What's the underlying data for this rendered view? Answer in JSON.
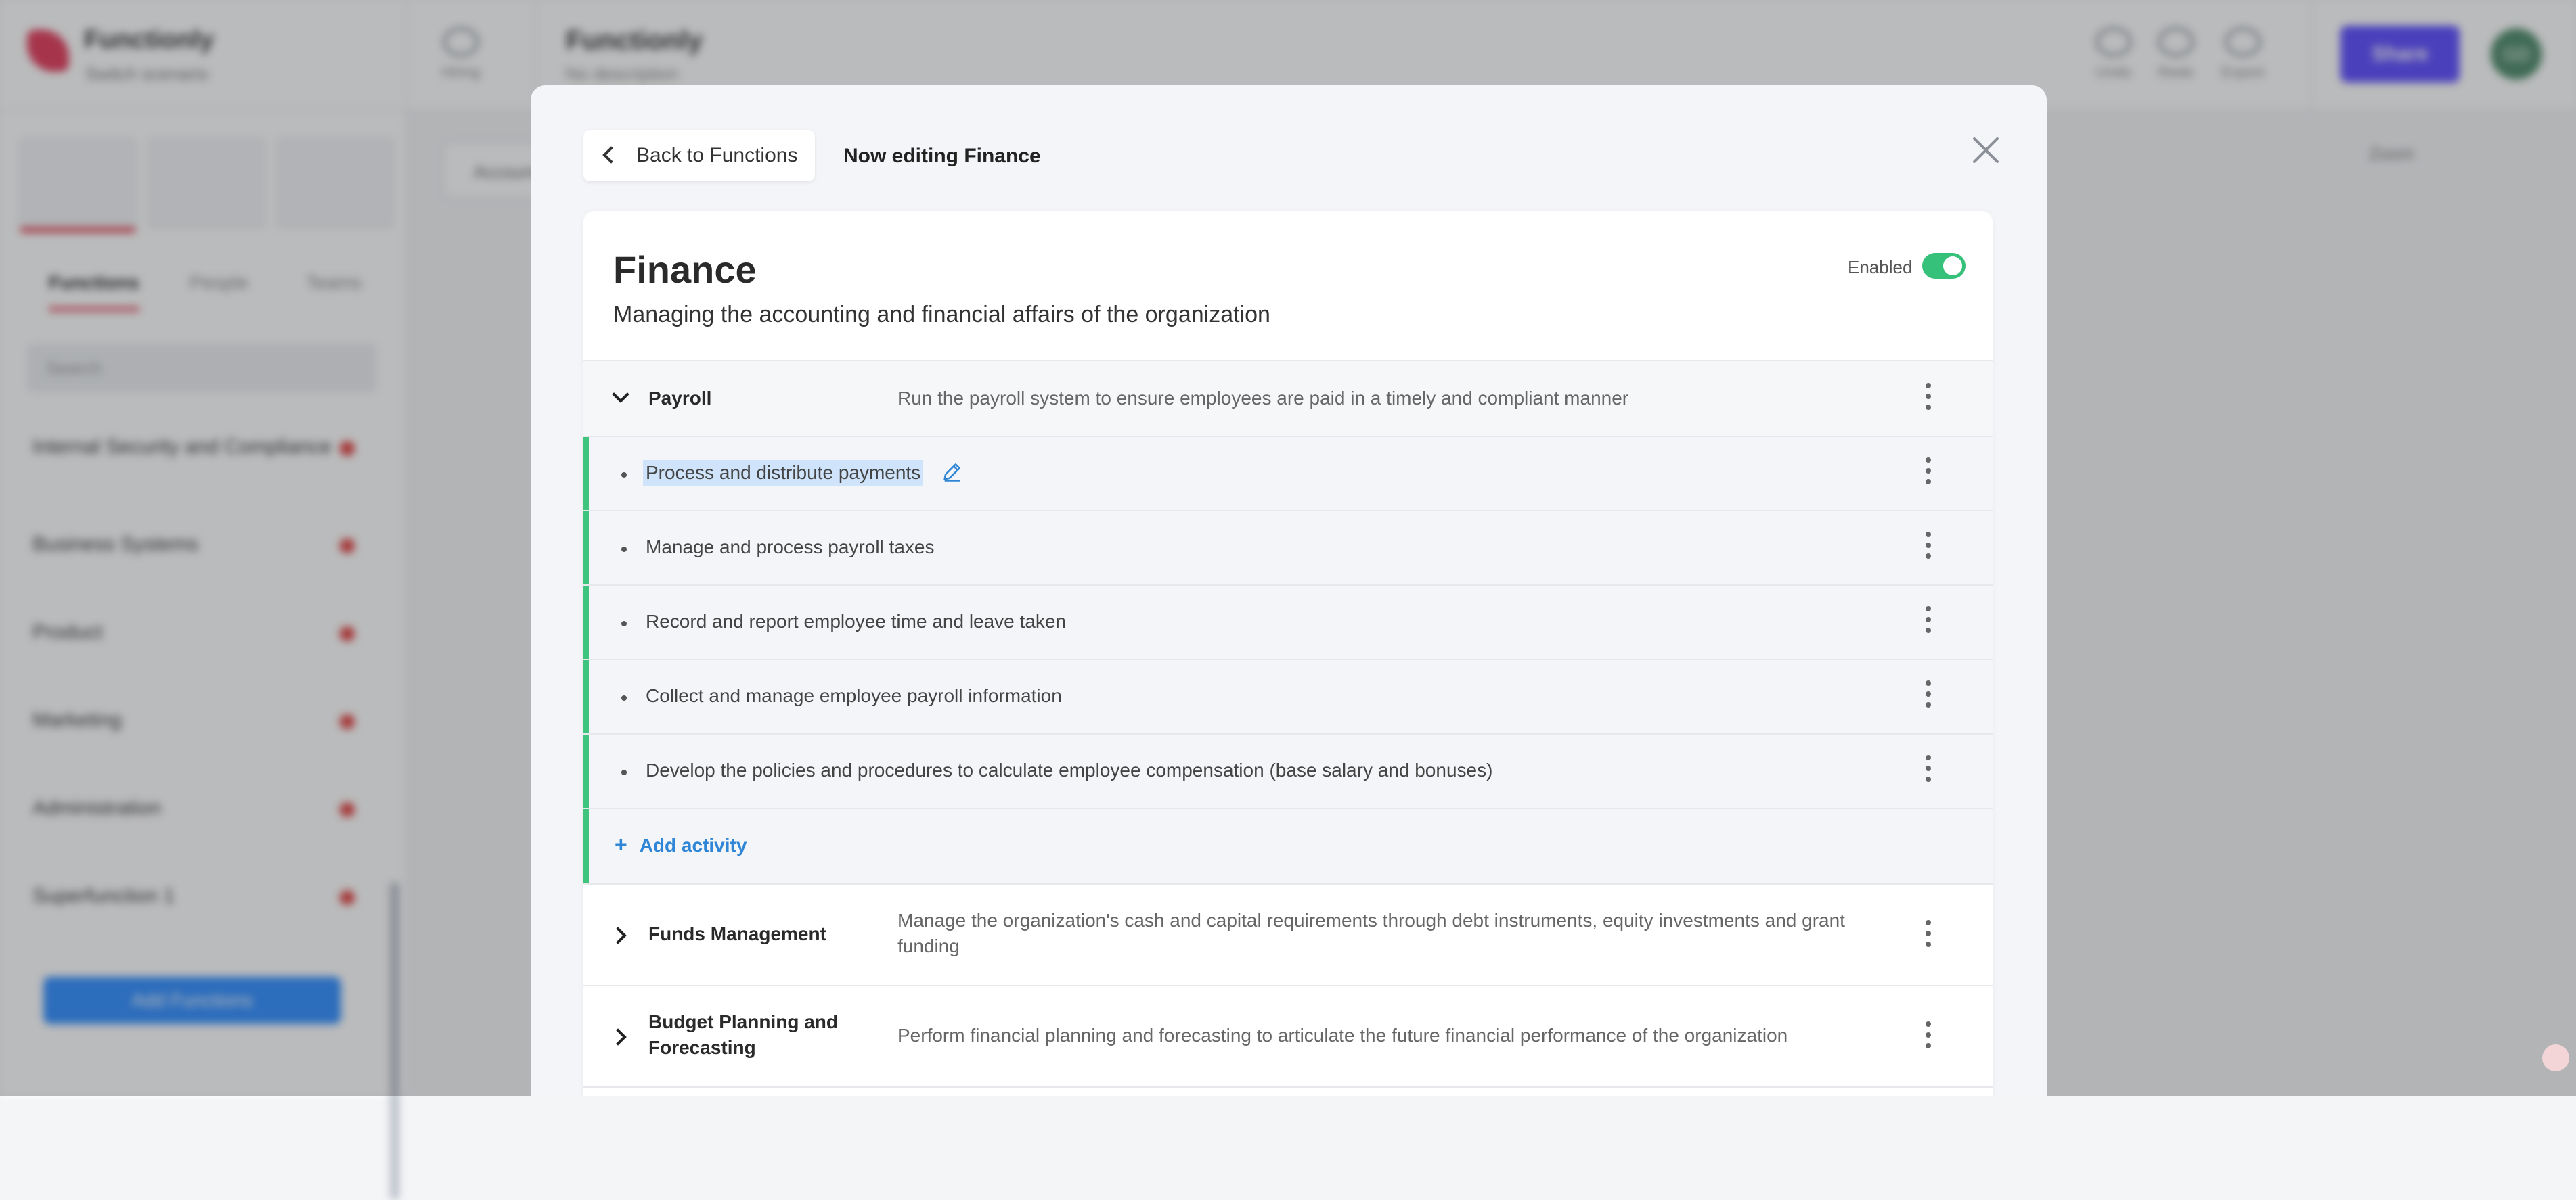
{
  "background": {
    "app_name": "Functionly",
    "scenario": "Switch scenario",
    "hiring_label": "Hiring",
    "doc_title": "Functionly",
    "doc_description": "No description",
    "undo_label": "Undo",
    "redo_label": "Redo",
    "export_label": "Export",
    "share_label": "Share",
    "avatar_initials": "GD",
    "sidebar_tabs": [
      "Functions",
      "People",
      "Teams"
    ],
    "search_placeholder": "Search",
    "sidebar_items": [
      "Internal Security and Compliance",
      "Business Systems",
      "Product",
      "Marketing",
      "Administration",
      "Superfunction 1"
    ],
    "add_functions_label": "Add Functions",
    "canvas_button": "Accounts",
    "zoom_label": "Zoom"
  },
  "modal": {
    "back_label": "Back to Functions",
    "editing_label": "Now editing Finance",
    "function_name": "Finance",
    "function_description": "Managing the accounting and financial affairs of the organization",
    "enabled_label": "Enabled",
    "enabled": true,
    "groups": [
      {
        "name": "Payroll",
        "description": "Run the payroll system to ensure employees are paid in a timely and compliant manner",
        "expanded": true,
        "activities": [
          "Process and distribute payments",
          "Manage and process payroll taxes",
          "Record and report employee time and leave taken",
          "Collect and manage employee payroll information",
          "Develop the policies and procedures to calculate employee compensation (base salary and bonuses)"
        ],
        "add_activity_label": "Add activity"
      },
      {
        "name": "Funds Management",
        "description": "Manage the organization's cash and capital requirements through debt instruments, equity investments and grant funding",
        "expanded": false
      },
      {
        "name": "Budget Planning and Forecasting",
        "description": "Perform financial planning and forecasting to articulate the future financial performance of the organization",
        "expanded": false
      }
    ]
  },
  "colors": {
    "accent_green": "#3fc47e",
    "link_blue": "#2f86d6",
    "share_purple": "#5b4bff"
  }
}
